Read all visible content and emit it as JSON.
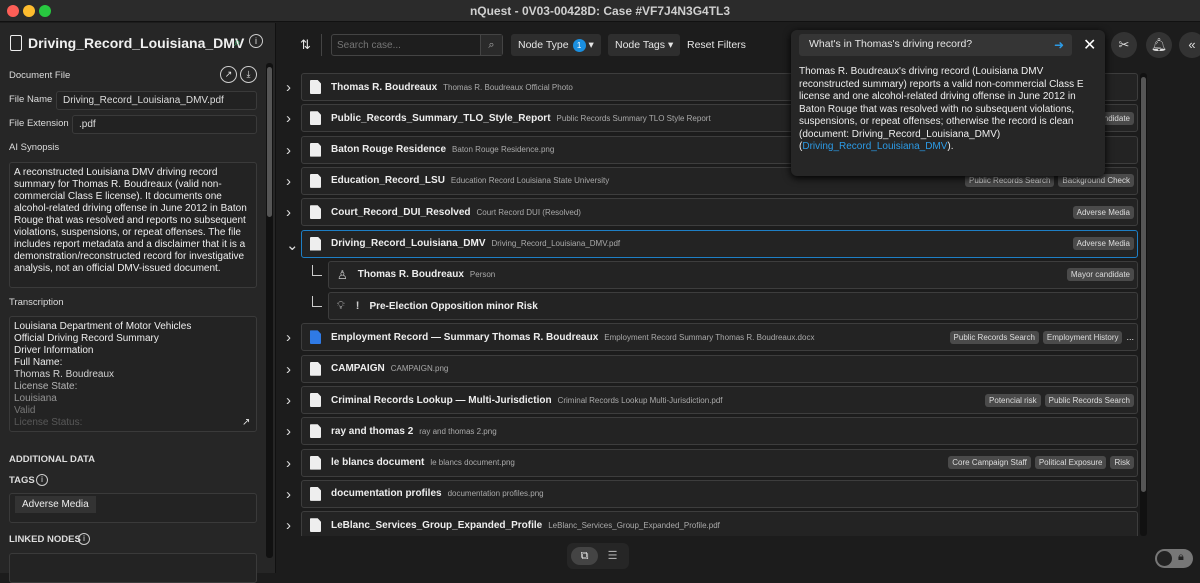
{
  "window": {
    "title": "nQuest - 0V03-00428D: Case #VF7J4N3G4TL3"
  },
  "left": {
    "title": "Driving_Record_Louisiana_DMV",
    "document_file_label": "Document File",
    "file_name_label": "File Name",
    "file_name": "Driving_Record_Louisiana_DMV.pdf",
    "file_ext_label": "File Extension",
    "file_ext": ".pdf",
    "synopsis_label": "AI Synopsis",
    "synopsis": "A reconstructed Louisiana DMV driving record summary for Thomas R. Boudreaux (valid non-commercial Class E license). It documents one alcohol-related driving offense in June 2012 in Baton Rouge that was resolved and reports no subsequent violations, suspensions, or repeat offenses. The file includes report metadata and a disclaimer that it is a demonstration/reconstructed record for investigative analysis, not an official DMV-issued document.",
    "transcription_label": "Transcription",
    "transcription_lines": [
      "Louisiana Department of Motor Vehicles",
      "Official Driving Record Summary",
      "Driver Information",
      "Full Name:",
      "Thomas R. Boudreaux",
      "License State:",
      "Louisiana",
      "Valid",
      "License Status:"
    ],
    "additional_label": "ADDITIONAL DATA",
    "tags_label": "TAGS",
    "tags": [
      "Adverse Media"
    ],
    "linked_label": "LINKED NODES"
  },
  "toolbar": {
    "search_placeholder": "Search case...",
    "node_type": "Node Type",
    "node_type_count": "1",
    "node_tags": "Node Tags",
    "reset": "Reset Filters"
  },
  "chat": {
    "question": "What's in Thomas's driving record?",
    "answer": "Thomas R. Boudreaux's driving record (Louisiana DMV reconstructed summary) reports a valid non-commercial Class E license and one alcohol-related driving offense in June 2012 in Baton Rouge that was resolved with no subsequent violations, suspensions, or repeat offenses; otherwise the record is clean (document: Driving_Record_Louisiana_DMV) (",
    "link": "Driving_Record_Louisiana_DMV",
    "answer_end": ")."
  },
  "rows": [
    {
      "name": "Thomas R. Boudreaux",
      "sub": "Thomas R. Boudreaux  Official Photo",
      "tags": []
    },
    {
      "name": "Public_Records_Summary_TLO_Style_Report",
      "sub": "Public Records Summary  TLO Style Report",
      "tags": [
        "Mayor candidate"
      ]
    },
    {
      "name": "Baton Rouge Residence",
      "sub": "Baton Rouge Residence.png",
      "tags": []
    },
    {
      "name": "Education_Record_LSU",
      "sub": "Education Record  Louisiana State University",
      "tags": [
        "Public Records Search",
        "Background Check"
      ]
    },
    {
      "name": "Court_Record_DUI_Resolved",
      "sub": "Court Record  DUI (Resolved)",
      "tags": [
        "Adverse Media"
      ]
    },
    {
      "name": "Driving_Record_Louisiana_DMV",
      "sub": "Driving_Record_Louisiana_DMV.pdf",
      "tags": [
        "Adverse Media"
      ],
      "expanded": true
    },
    {
      "name": "Thomas R. Boudreaux",
      "sub": "Person",
      "tags": [
        "Mayor candidate"
      ],
      "child": true,
      "icon": "person"
    },
    {
      "name": "Pre-Election Opposition minor Risk",
      "sub": "",
      "tags": [],
      "child": true,
      "icon": "bulb"
    },
    {
      "name": "Employment Record — Summary Thomas R. Boudreaux",
      "sub": "Employment Record  Summary Thomas R. Boudreaux.docx",
      "tags": [
        "Public Records Search",
        "Employment History"
      ],
      "more": "...",
      "icon": "word"
    },
    {
      "name": "CAMPAIGN",
      "sub": "CAMPAIGN.png",
      "tags": []
    },
    {
      "name": "Criminal Records Lookup — Multi-Jurisdiction",
      "sub": "Criminal Records Lookup  Multi-Jurisdiction.pdf",
      "tags": [
        "Potencial risk",
        "Public Records Search"
      ]
    },
    {
      "name": "ray and thomas 2",
      "sub": "ray and thomas 2.png",
      "tags": []
    },
    {
      "name": "le blancs document",
      "sub": "le blancs document.png",
      "tags": [
        "Core Campaign Staff",
        "Political Exposure",
        "Risk"
      ]
    },
    {
      "name": "documentation profiles",
      "sub": "documentation profiles.png",
      "tags": []
    },
    {
      "name": "LeBlanc_Services_Group_Expanded_Profile",
      "sub": "LeBlanc_Services_Group_Expanded_Profile.pdf",
      "tags": []
    }
  ]
}
